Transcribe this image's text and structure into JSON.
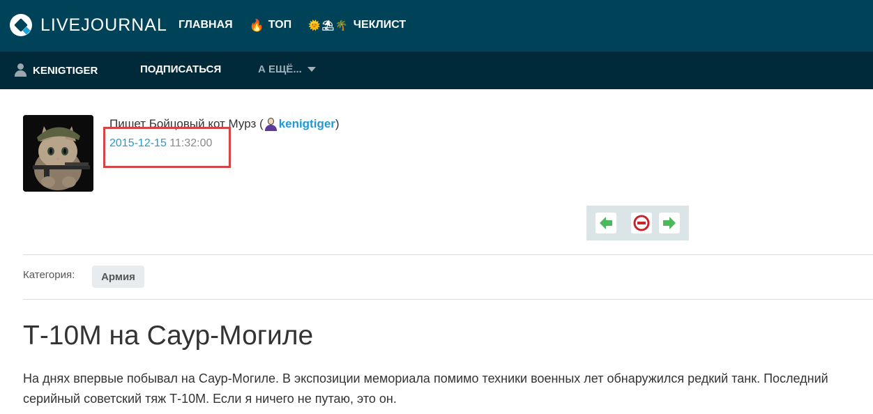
{
  "header": {
    "logo_text": "LIVEJOURNAL",
    "nav": [
      {
        "label": "ГЛАВНАЯ",
        "icon": ""
      },
      {
        "label": "ТОП",
        "icon": "fire-emoji"
      },
      {
        "label": "ЧЕКЛИСТ",
        "icon": "sun-sand-palm-emoji"
      }
    ],
    "colors": {
      "top_bar": "#004359",
      "sub_bar": "#00293a",
      "link": "#1f9ad6"
    }
  },
  "journal_bar": {
    "username": "KENIGTIGER",
    "subscribe_label": "ПОДПИСАТЬСЯ",
    "more_label": "А ЕЩЁ..."
  },
  "post": {
    "author_prefix": "Пишет Бойцовый кот Мурз (",
    "author_username": "kenigtiger",
    "author_suffix": ")",
    "date": "2015-12-15",
    "time": "11:32:00",
    "category_label": "Категория:",
    "category_tag": "Армия",
    "title": "Т-10М на Саур-Могиле",
    "body": "На днях впервые побывал на Саур-Могиле. В экспозиции мемориала помимо техники военных лет обнаружился редкий танк. Последний серийный советский тяж Т-10М. Если я ничего не путаю, это он."
  },
  "entry_nav": {
    "prev_icon": "green-left-arrow-icon",
    "stop_icon": "red-no-entry-icon",
    "next_icon": "green-right-arrow-icon"
  }
}
